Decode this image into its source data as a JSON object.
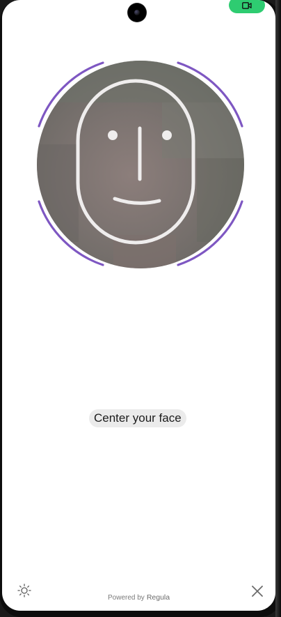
{
  "status_bar": {
    "recording_icon": "video-camera-icon",
    "recording_color": "#2ecc71"
  },
  "face_capture": {
    "frame_color": "#7e57c2",
    "face_outline_color": "#efeded",
    "face_outline_icon": "face-outline-icon"
  },
  "hint": {
    "text": "Center your face"
  },
  "footer": {
    "powered_by": "Powered by",
    "brand_name": "Regula",
    "brightness_icon": "sun-icon",
    "close_icon": "close-icon"
  }
}
